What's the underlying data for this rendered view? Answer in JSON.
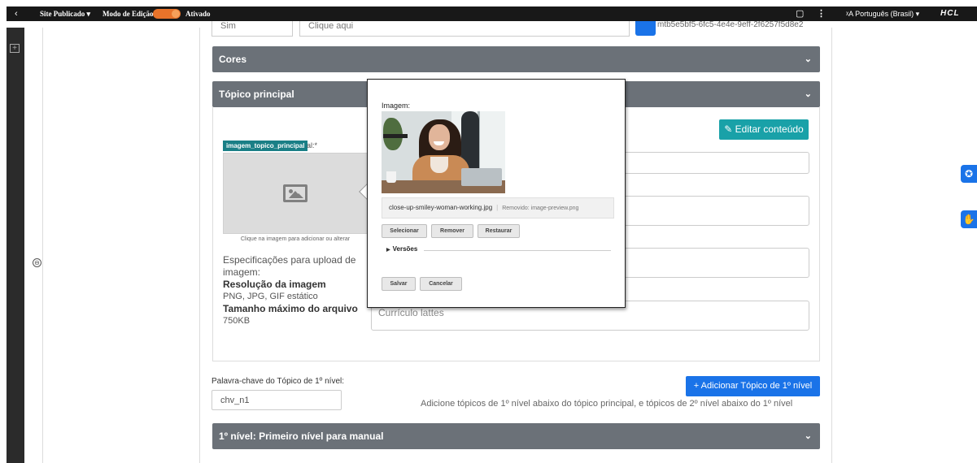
{
  "topbar": {
    "back_glyph": "‹",
    "site_status": "Site Publicado ▾",
    "edit_mode_label": "Modo de Edição:",
    "edit_mode_state": "Ativado",
    "panel_icon": "▢",
    "kebab_glyph": "⋮",
    "language": "ᵡA Português (Brasil) ▾",
    "logo": "HCL"
  },
  "leftrail": {
    "add_glyph": "+"
  },
  "side_arrow_glyph": "⊖",
  "top_fields": {
    "field1_value": "Sim",
    "field2_placeholder": "Clique aqui",
    "uuid_text": "mtb5e5bf5-6fc5-4e4e-9eff-2f6257f5d8e2"
  },
  "sections": {
    "cores_title": "Cores",
    "topico_title": "Tópico principal",
    "nivel1_title": "1º nível: Primeiro nível para manual",
    "chevron": "⌄"
  },
  "topico": {
    "edit_button": "✎ Editar conteúdo",
    "image_tag": "imagem_topico_principal",
    "image_label_suffix": "al:*",
    "image_hint": "Clique na imagem para adicionar ou alterar",
    "spec_intro": "Especificações para upload de imagem:",
    "res_label": "Resolução da imagem",
    "res_formats": "PNG, JPG, GIF estático",
    "max_label": "Tamanho máximo do arquivo",
    "max_value": "750KB",
    "curriculo_placeholder": "Currículo lattes"
  },
  "keyword": {
    "label": "Palavra-chave do Tópico de 1º nível:",
    "value": "chv_n1"
  },
  "add_topic": {
    "button": "+ Adicionar Tópico de 1º nível",
    "hint": "Adicione tópicos de 1º nível abaixo do tópico principal, e tópicos de 2º nível abaixo do 1º nível"
  },
  "popup": {
    "image_label": "Imagem:",
    "file_name": "close-up-smiley-woman-working.jpg",
    "removed_text": "Removido: image-preview.png",
    "btn_select": "Selecionar",
    "btn_remove": "Remover",
    "btn_restore": "Restaurar",
    "versions_label": "Versões",
    "btn_save": "Salvar",
    "btn_cancel": "Cancelar"
  },
  "right_icons": {
    "accessibility": "✪",
    "sign_language": "✋"
  },
  "colors": {
    "accent_blue": "#1a73e8",
    "teal": "#19a1a8",
    "section_bar": "#6b7178",
    "toggle_orange": "#e8732a"
  }
}
